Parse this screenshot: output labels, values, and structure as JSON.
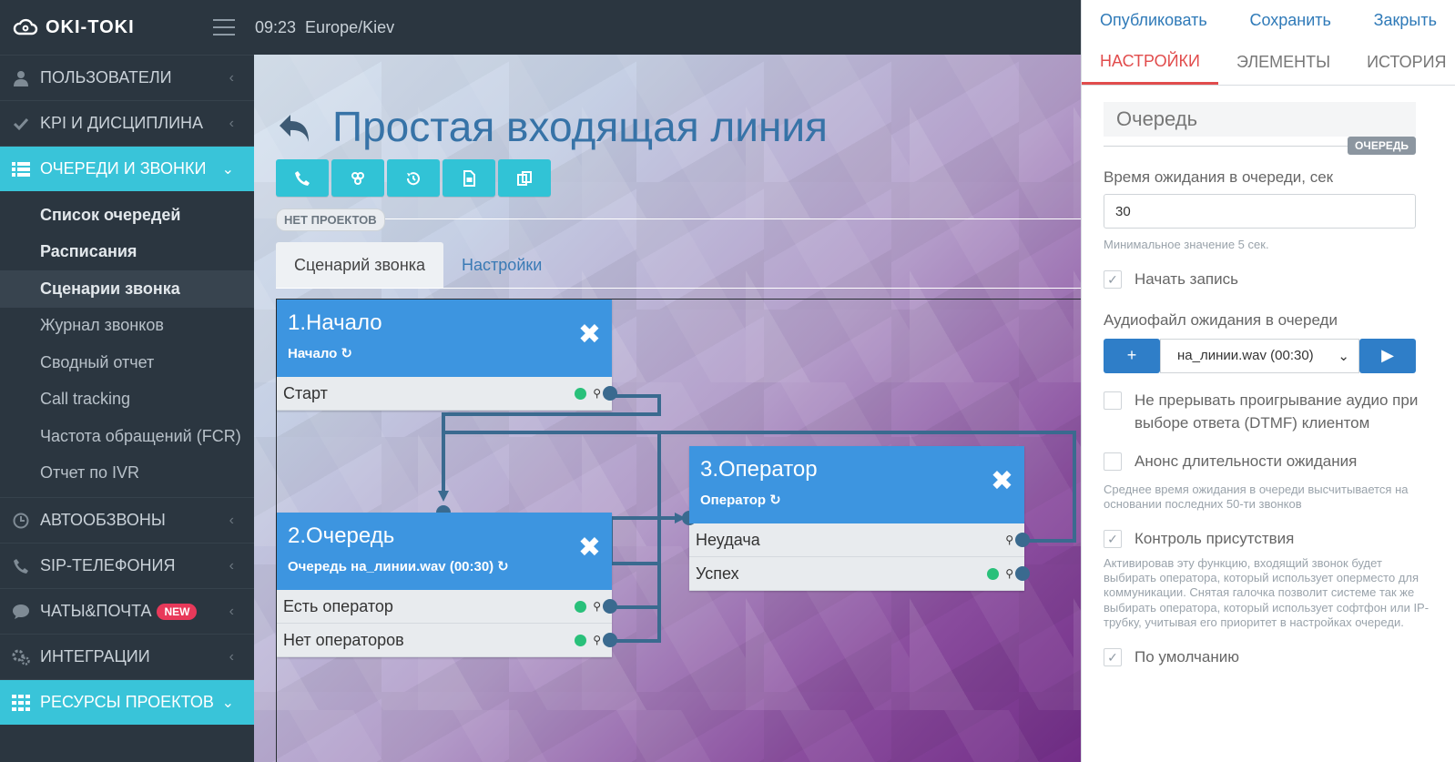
{
  "topbar": {
    "brand": "OKI-TOKI",
    "time": "09:23",
    "timezone": "Europe/Kiev"
  },
  "sidebar": {
    "sections": [
      {
        "label": "ПОЛЬЗОВАТЕЛИ",
        "icon": "user-icon",
        "active": false
      },
      {
        "label": "KPI И ДИСЦИПЛИНА",
        "icon": "check-icon",
        "active": false
      },
      {
        "label": "ОЧЕРЕДИ И ЗВОНКИ",
        "icon": "list-icon",
        "active": true
      }
    ],
    "subitems": [
      {
        "label": "Список очередей",
        "bold": true
      },
      {
        "label": "Расписания",
        "bold": true
      },
      {
        "label": "Сценарии звонка",
        "bold": true,
        "current": true
      },
      {
        "label": "Журнал звонков"
      },
      {
        "label": "Сводный отчет"
      },
      {
        "label": "Call tracking"
      },
      {
        "label": "Частота обращений (FCR)"
      },
      {
        "label": "Отчет по IVR"
      }
    ],
    "lower": [
      {
        "label": "АВТООБЗВОНЫ",
        "icon": "clock-icon"
      },
      {
        "label": "SIP-ТЕЛЕФОНИЯ",
        "icon": "phone-icon"
      },
      {
        "label": "ЧАТЫ&ПОЧТА",
        "icon": "chat-icon",
        "badge": "NEW"
      },
      {
        "label": "ИНТЕГРАЦИИ",
        "icon": "gears-icon"
      },
      {
        "label": "РЕСУРСЫ ПРОЕКТОВ",
        "icon": "grid-icon",
        "active": true
      }
    ]
  },
  "main": {
    "title": "Простая входящая линия",
    "no_projects": "НЕТ ПРОЕКТОВ",
    "tabs": [
      "Сценарий звонка",
      "Настройки"
    ]
  },
  "nodes": {
    "start": {
      "title": "1.Начало",
      "sub": "Начало",
      "rows": [
        "Старт"
      ]
    },
    "queue": {
      "title": "2.Очередь",
      "sub": "Очередь на_линии.wav (00:30)",
      "rows": [
        "Есть оператор",
        "Нет операторов"
      ]
    },
    "operator": {
      "title": "3.Оператор",
      "sub": "Оператор",
      "rows": [
        "Неудача",
        "Успех"
      ]
    }
  },
  "panel": {
    "actions": {
      "publish": "Опубликовать",
      "save": "Сохранить",
      "close": "Закрыть"
    },
    "tabs": [
      "НАСТРОЙКИ",
      "ЭЛЕМЕНТЫ",
      "ИСТОРИЯ"
    ],
    "name": "Очередь",
    "type_tag": "ОЧЕРЕДЬ",
    "wait_label": "Время ожидания в очереди, сек",
    "wait_value": "30",
    "wait_hint": "Минимальное значение 5 сек.",
    "record_label": "Начать запись",
    "audio_label": "Аудиофайл ожидания в очереди",
    "audio_value": "на_линии.wav (00:30)",
    "dtmf_label": "Не прерывать проигрывание аудио при выборе ответа (DTMF) клиентом",
    "announce_label": "Анонс длительности ожидания",
    "announce_hint": "Среднее время ожидания в очереди высчитывается на основании последних 50-ти звонков",
    "presence_label": "Контроль присутствия",
    "presence_hint": "Активировав эту функцию, входящий звонок будет выбирать оператора, который использует оперместо для коммуникации. Снятая галочка позволит системе так же выбирать оператора, который использует софтфон или IP-трубку, учитывая его приоритет в настройках очереди.",
    "default_label": "По умолчанию"
  }
}
